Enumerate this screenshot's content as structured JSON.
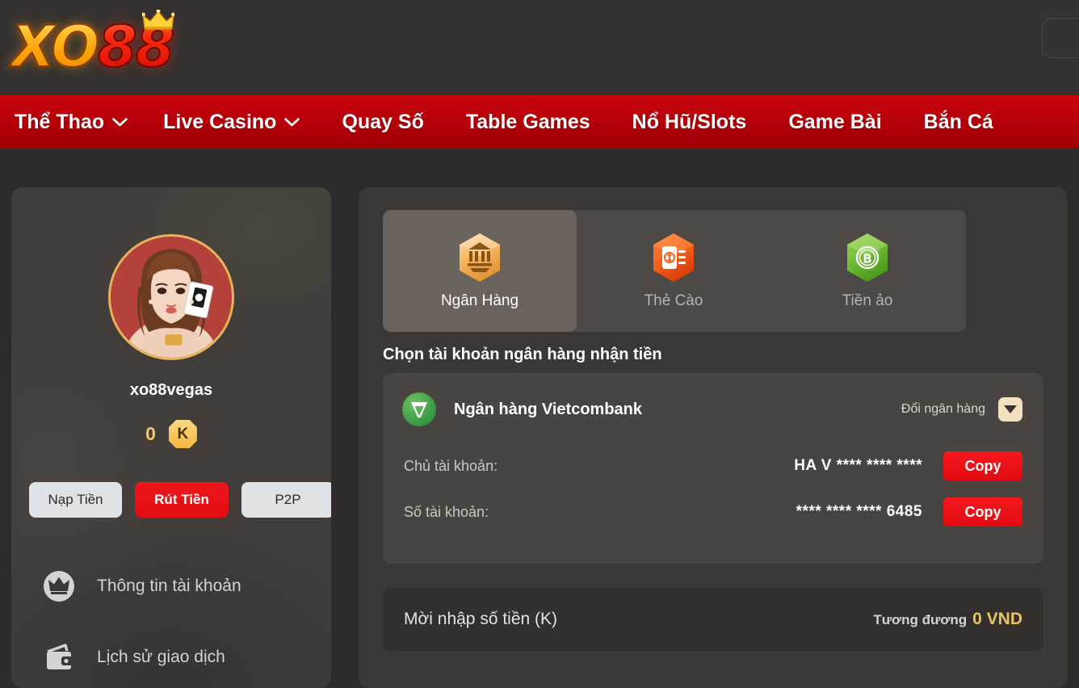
{
  "header": {
    "logo_xo": "XO",
    "logo_88": "88",
    "logo_alt": "xo88-logo"
  },
  "nav": {
    "items": [
      {
        "label": "Thể Thao",
        "has_chevron": true
      },
      {
        "label": "Live Casino",
        "has_chevron": true
      },
      {
        "label": "Quay Số",
        "has_chevron": false
      },
      {
        "label": "Table Games",
        "has_chevron": false
      },
      {
        "label": "Nổ Hũ/Slots",
        "has_chevron": false
      },
      {
        "label": "Game Bài",
        "has_chevron": false
      },
      {
        "label": "Bắn Cá",
        "has_chevron": false
      }
    ]
  },
  "sidebar": {
    "username": "xo88vegas",
    "balance": "0",
    "currency_badge": "K",
    "actions": [
      {
        "label": "Nạp Tiền",
        "active": false
      },
      {
        "label": "Rút Tiền",
        "active": true
      },
      {
        "label": "P2P",
        "active": false
      }
    ],
    "menu": [
      {
        "label": "Thông tin tài khoản",
        "icon": "crown-icon"
      },
      {
        "label": "Lịch sử giao dịch",
        "icon": "wallet-icon"
      }
    ]
  },
  "content": {
    "methods": [
      {
        "label": "Ngân Hàng",
        "icon": "bank-hexagon-icon",
        "active": true
      },
      {
        "label": "Thẻ Cào",
        "icon": "prepaid-card-hexagon-icon",
        "active": false
      },
      {
        "label": "Tiền ảo",
        "icon": "crypto-bitcoin-hexagon-icon",
        "active": false
      }
    ],
    "section_title": "Chọn tài khoản ngân hàng nhận tiền",
    "bank": {
      "name": "Ngân hàng Vietcombank",
      "change_label": "Đổi ngân hàng",
      "fields": [
        {
          "label": "Chủ tài khoản:",
          "value": "HA V **** **** ****",
          "copy_label": "Copy"
        },
        {
          "label": "Số tài khoản:",
          "value": "**** **** **** 6485",
          "copy_label": "Copy"
        }
      ]
    },
    "amount": {
      "placeholder": "Mời nhập số tiền (K)",
      "equivalent_label": "Tương đương",
      "equivalent_value": "0 VND"
    }
  },
  "colors": {
    "nav_red": "#b40009",
    "accent_gold": "#e9c45f",
    "copy_red": "#e20b11",
    "page_bg": "#2e2b2a",
    "card_bg": "#3b3735"
  }
}
